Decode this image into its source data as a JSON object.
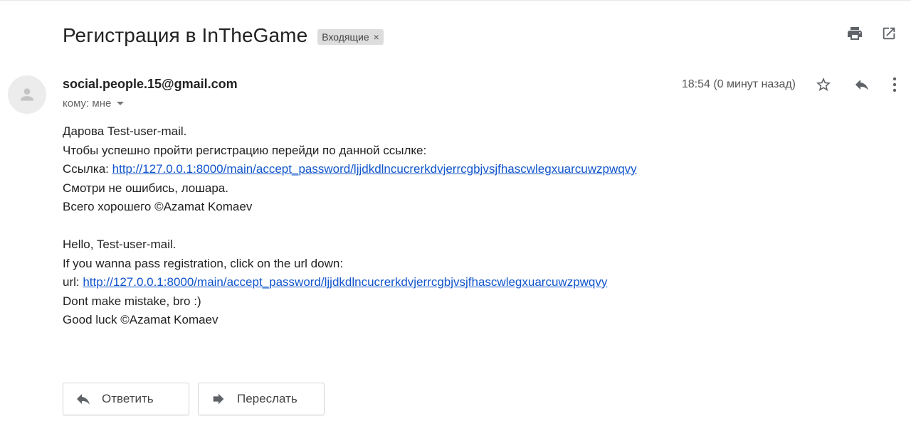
{
  "email": {
    "subject": "Регистрация в InTheGame",
    "label": "Входящие",
    "label_remove": "×",
    "sender": "social.people.15@gmail.com",
    "recipient": "кому: мне",
    "timestamp": "18:54 (0 минут назад)",
    "body_lines_ru": [
      "Дарова Test-user-mail.",
      "Чтобы успешно пройти регистрацию перейди по данной ссылке:"
    ],
    "link_prefix_ru": "Ссылка: ",
    "link_url": "http://127.0.0.1:8000/main/accept_password/ljjdkdlncucrerkdvjerrcgbjvsjfhascwlegxuarcuwzpwqvy",
    "body_lines_ru_after": [
      "Смотри не ошибись, лошара.",
      "Всего хорошего ©Azamat Komaev"
    ],
    "body_lines_en": [
      "Hello, Test-user-mail.",
      "If you wanna pass registration, click on the url down:"
    ],
    "link_prefix_en": "url: ",
    "body_lines_en_after": [
      "Dont make mistake, bro :)",
      "Good luck ©Azamat Komaev"
    ]
  },
  "actions": {
    "reply_label": "Ответить",
    "forward_label": "Переслать"
  },
  "icons": {
    "print": "print-icon",
    "open_new_window": "open-in-new-window-icon",
    "star": "star-icon",
    "reply": "reply-icon",
    "more": "more-vertical-icon",
    "avatar": "person-icon",
    "forward": "forward-icon"
  },
  "colors": {
    "link": "#1155cc",
    "label_chip": "#dddddd",
    "icon": "#5f6368"
  }
}
